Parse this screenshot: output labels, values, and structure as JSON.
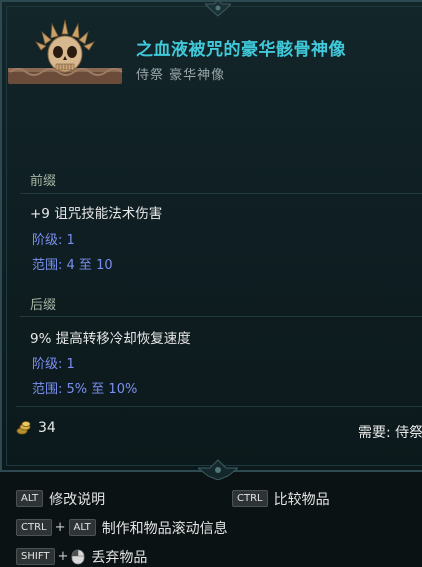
{
  "item": {
    "name": "之血液被咒的豪华骸骨神像",
    "subtitle": "侍祭 豪华神像"
  },
  "prefix": {
    "label": "前缀",
    "mod_text": "+9 诅咒技能法术伤害",
    "tier_label": "阶级:",
    "tier_value": "1",
    "range_label": "范围:",
    "range_value": "4 至 10"
  },
  "suffix": {
    "label": "后缀",
    "mod_text": "9% 提高转移冷却恢复速度",
    "tier_label": "阶级:",
    "tier_value": "1",
    "range_label": "范围:",
    "range_value": "5% 至 10%"
  },
  "footer": {
    "currency_icon": "gold-coins-icon",
    "currency_value": "34",
    "requirement": "需要: 侍祭"
  },
  "hints": {
    "alt_key": "ALT",
    "alt_label": "修改说明",
    "ctrl_key": "CTRL",
    "ctrl_label": "比较物品",
    "combo_ctrl": "CTRL",
    "combo_plus": "+",
    "combo_alt": "ALT",
    "combo_label": "制作和物品滚动信息",
    "shift_key": "SHIFT",
    "shift_plus": "+",
    "shift_label": "丢弃物品"
  },
  "colors": {
    "title": "#3fc9d9",
    "mod_meta": "#7b8ff0",
    "section_label": "#a9b7a7"
  }
}
